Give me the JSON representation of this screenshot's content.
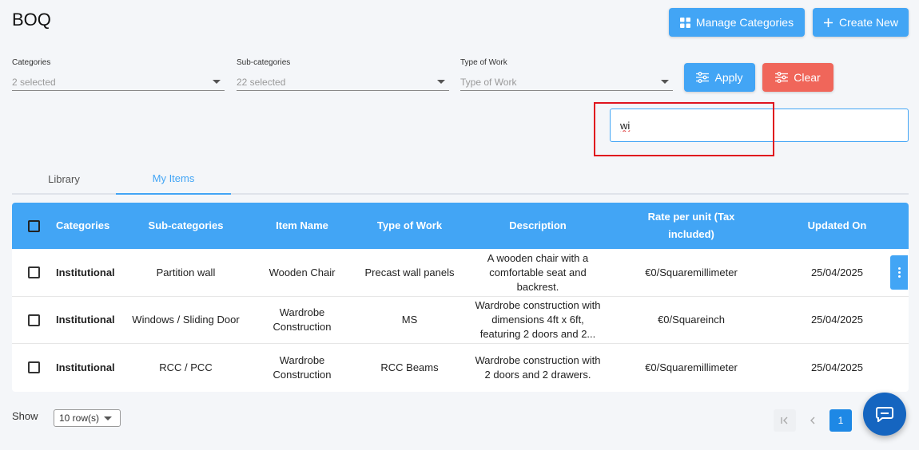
{
  "page": {
    "title": "BOQ"
  },
  "header": {
    "manage_label": "Manage Categories",
    "create_label": "Create New"
  },
  "filters": {
    "categories": {
      "label": "Categories",
      "value": "2 selected"
    },
    "subcategories": {
      "label": "Sub-categories",
      "value": "22 selected"
    },
    "type_of_work": {
      "label": "Type of Work",
      "value": "Type of Work"
    },
    "apply_label": "Apply",
    "clear_label": "Clear"
  },
  "search": {
    "value": "wi"
  },
  "tabs": [
    {
      "label": "Library"
    },
    {
      "label": "My Items"
    }
  ],
  "table": {
    "headers": {
      "categories": "Categories",
      "subcategories": "Sub-categories",
      "item_name": "Item Name",
      "type_of_work": "Type of Work",
      "description": "Description",
      "rate": "Rate per unit (Tax included)",
      "updated": "Updated On"
    },
    "rows": [
      {
        "category": "Institutional",
        "subcategory": "Partition wall",
        "item_name": "Wooden Chair",
        "type_of_work": "Precast wall panels",
        "description": "A wooden chair with a comfortable seat and backrest.",
        "rate": "€0/Squaremillimeter",
        "updated": "25/04/2025"
      },
      {
        "category": "Institutional",
        "subcategory": "Windows / Sliding Door",
        "item_name": "Wardrobe Construction",
        "type_of_work": "MS",
        "description": "Wardrobe construction with dimensions 4ft x 6ft, featuring 2 doors and 2...",
        "rate": "€0/Squareinch",
        "updated": "25/04/2025"
      },
      {
        "category": "Institutional",
        "subcategory": "RCC / PCC",
        "item_name": "Wardrobe Construction",
        "type_of_work": "RCC Beams",
        "description": "Wardrobe construction with 2 doors and 2 drawers.",
        "rate": "€0/Squaremillimeter",
        "updated": "25/04/2025"
      }
    ]
  },
  "footer": {
    "show_label": "Show",
    "rows_value": "10 row(s)",
    "current_page": "1"
  },
  "colors": {
    "accent": "#42a5f5",
    "danger": "#f0665a",
    "chat": "#1565c0"
  }
}
